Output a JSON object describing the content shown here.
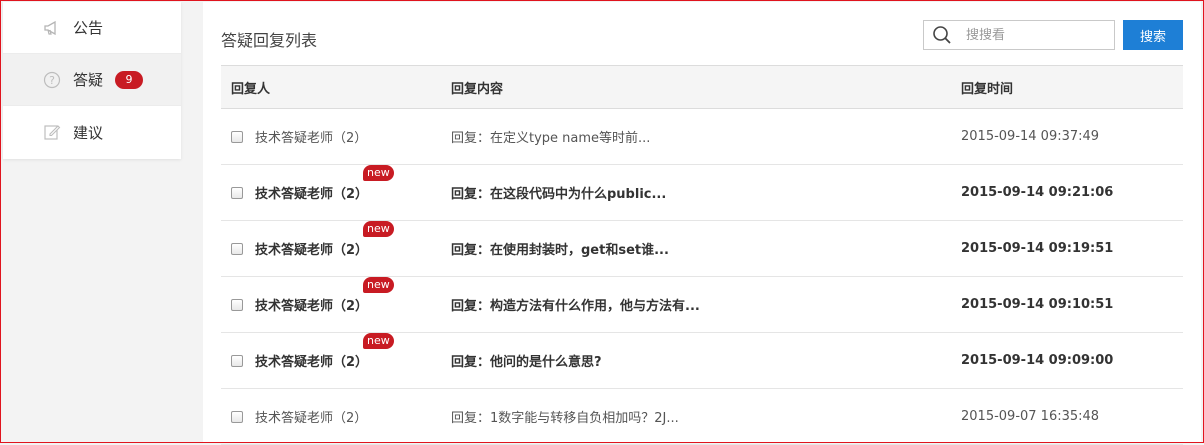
{
  "sidebar": {
    "items": [
      {
        "label": "公告",
        "icon": "megaphone-icon",
        "active": false
      },
      {
        "label": "答疑",
        "icon": "question-circle-icon",
        "active": true,
        "badge": "9"
      },
      {
        "label": "建议",
        "icon": "edit-icon",
        "active": false
      }
    ]
  },
  "main": {
    "title": "答疑回复列表",
    "search": {
      "placeholder": "搜搜看",
      "button_label": "搜索"
    },
    "table": {
      "headers": [
        "回复人",
        "回复内容",
        "回复时间"
      ],
      "rows": [
        {
          "sender": "技术答疑老师（2）",
          "content": "回复：在定义type name等时前...",
          "time": "2015-09-14 09:37:49",
          "unread": false
        },
        {
          "sender": "技术答疑老师（2）",
          "content": "回复：在这段代码中为什么public...",
          "time": "2015-09-14 09:21:06",
          "unread": true,
          "tag": "new"
        },
        {
          "sender": "技术答疑老师（2）",
          "content": "回复：在使用封装时，get和set谁...",
          "time": "2015-09-14 09:19:51",
          "unread": true,
          "tag": "new"
        },
        {
          "sender": "技术答疑老师（2）",
          "content": "回复：构造方法有什么作用，他与方法有...",
          "time": "2015-09-14 09:10:51",
          "unread": true,
          "tag": "new"
        },
        {
          "sender": "技术答疑老师（2）",
          "content": "回复：他问的是什么意思?",
          "time": "2015-09-14 09:09:00",
          "unread": true,
          "tag": "new"
        },
        {
          "sender": "技术答疑老师（2）",
          "content": "回复：1数字能与转移自负相加吗？2J...",
          "time": "2015-09-07 16:35:48",
          "unread": false
        }
      ]
    }
  },
  "colors": {
    "accent": "#1e7fd6",
    "badge": "#c81b23",
    "frame": "#e0141e"
  }
}
